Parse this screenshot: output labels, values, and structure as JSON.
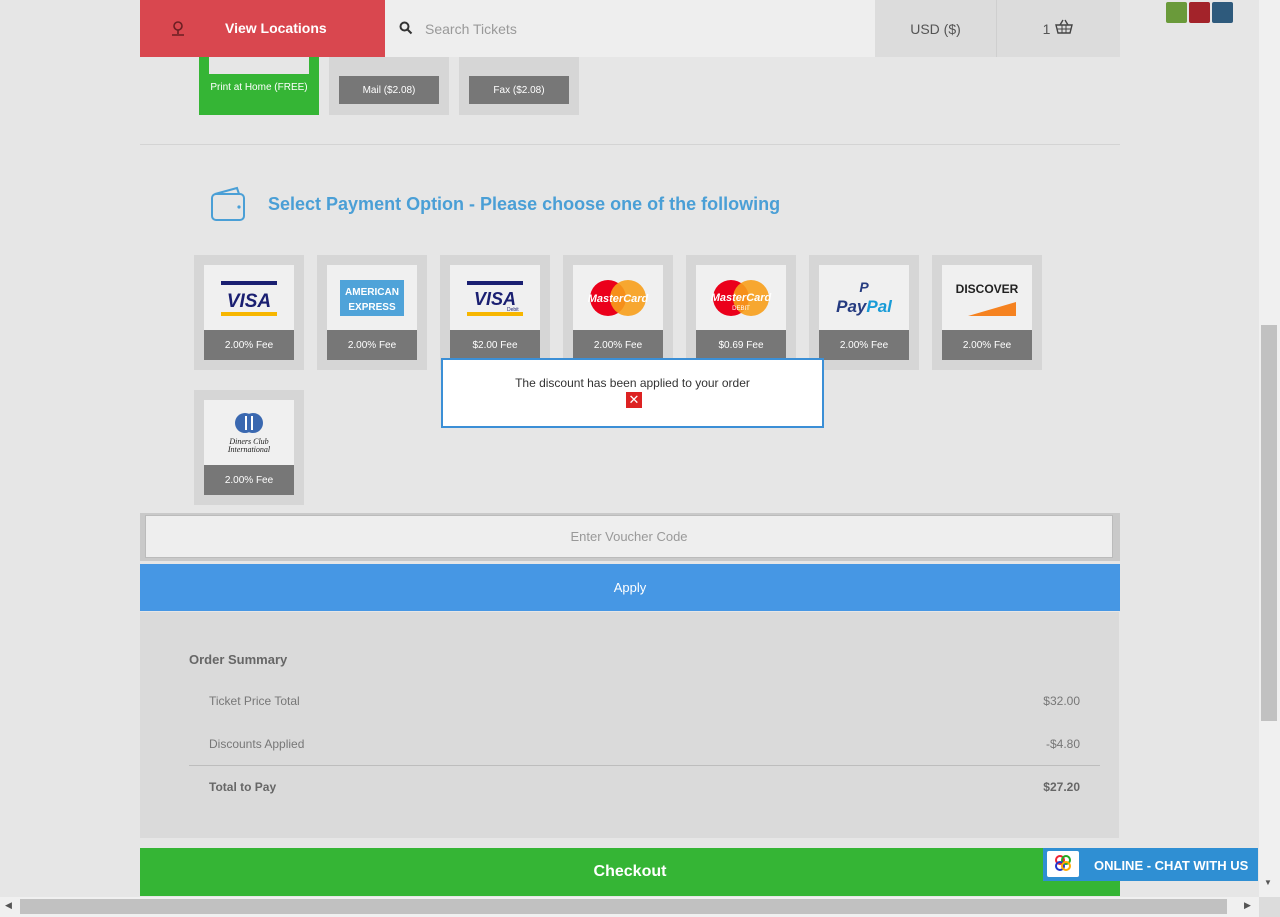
{
  "nav": {
    "view_locations": "View Locations",
    "search_placeholder": "Search Tickets",
    "currency": "USD ($)",
    "cart_count": "1"
  },
  "delivery": {
    "print": "Print at Home (FREE)",
    "mail": "Mail ($2.08)",
    "fax": "Fax ($2.08)"
  },
  "payment": {
    "heading": "Select Payment Option - Please choose one of the following",
    "options": [
      {
        "brand": "VISA",
        "fee": "2.00% Fee"
      },
      {
        "brand": "AMERICAN EXPRESS",
        "fee": "2.00% Fee"
      },
      {
        "brand": "VISA Debit",
        "fee": "$2.00 Fee"
      },
      {
        "brand": "MasterCard",
        "fee": "2.00% Fee"
      },
      {
        "brand": "MasterCard DEBIT",
        "fee": "$0.69 Fee"
      },
      {
        "brand": "PayPal",
        "fee": "2.00% Fee"
      },
      {
        "brand": "DISCOVER",
        "fee": "2.00% Fee"
      },
      {
        "brand": "Diners Club International",
        "fee": "2.00% Fee"
      }
    ]
  },
  "toast": {
    "message": "The discount has been applied to your order"
  },
  "voucher": {
    "placeholder": "Enter Voucher Code",
    "apply_label": "Apply"
  },
  "summary": {
    "title": "Order Summary",
    "rows": [
      {
        "label": "Ticket Price Total",
        "value": "$32.00"
      },
      {
        "label": "Discounts Applied",
        "value": "-$4.80"
      },
      {
        "label": "Total to Pay",
        "value": "$27.20"
      }
    ]
  },
  "checkout_label": "Checkout",
  "chat_label": "ONLINE - CHAT WITH US",
  "colors": {
    "nav_red": "#d9474f",
    "green": "#35b535",
    "blue": "#4697e4",
    "heading_blue": "#4a9fd6"
  }
}
